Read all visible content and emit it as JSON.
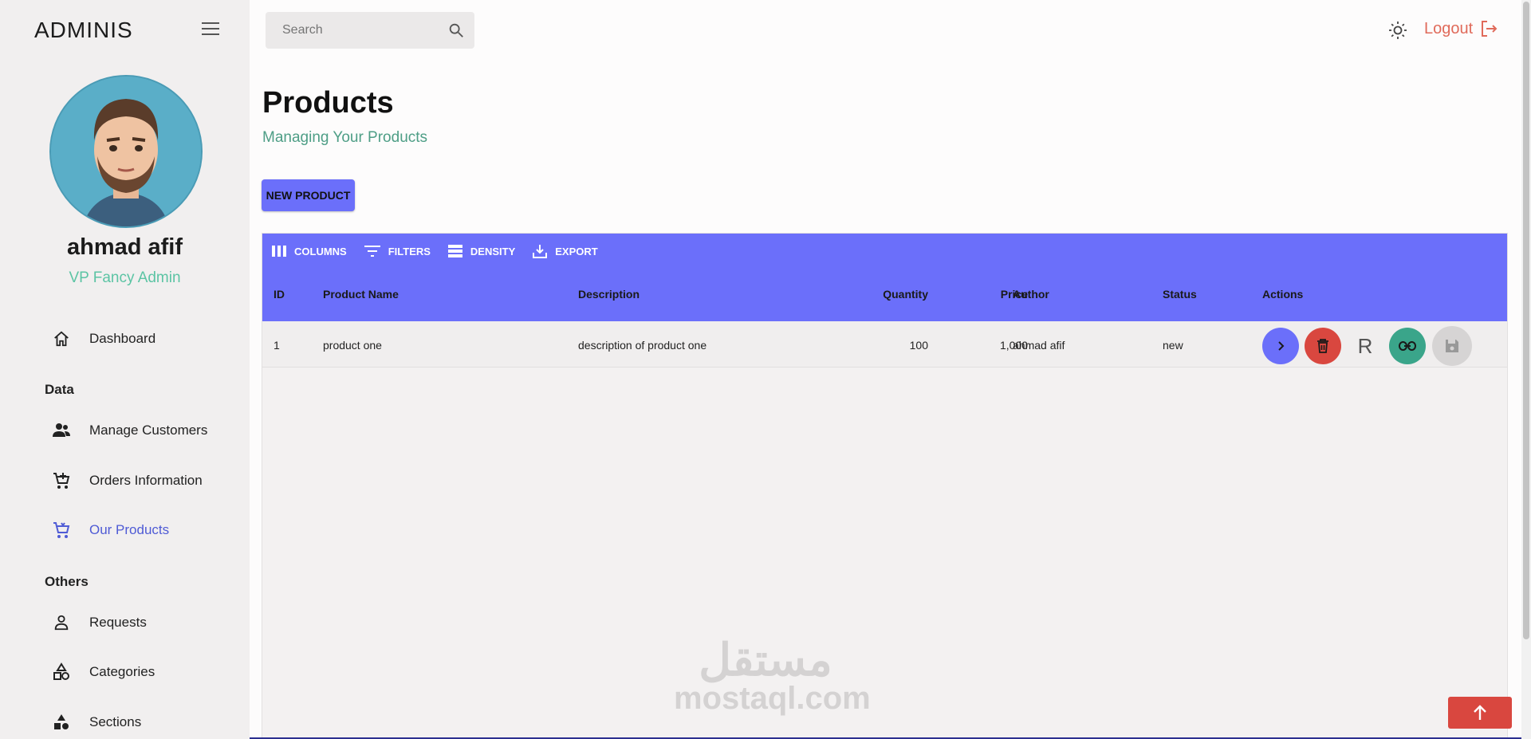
{
  "brand": "ADMINIS",
  "user": {
    "name": "ahmad afif",
    "role": "VP Fancy Admin"
  },
  "nav": {
    "dashboard": "Dashboard",
    "section_data": "Data",
    "customers": "Manage Customers",
    "orders": "Orders Information",
    "products": "Our Products",
    "section_others": "Others",
    "requests": "Requests",
    "categories": "Categories",
    "sections": "Sections"
  },
  "search": {
    "placeholder": "Search"
  },
  "topbar": {
    "logout": "Logout"
  },
  "page": {
    "title": "Products",
    "subtitle": "Managing Your Products",
    "new_button": "NEW PRODUCT"
  },
  "toolbar": {
    "columns": "COLUMNS",
    "filters": "FILTERS",
    "density": "DENSITY",
    "export": "EXPORT"
  },
  "table": {
    "headers": {
      "id": "ID",
      "name": "Product Name",
      "description": "Description",
      "quantity": "Quantity",
      "price": "Price",
      "author": "Author",
      "status": "Status",
      "actions": "Actions"
    },
    "rows": [
      {
        "id": "1",
        "name": "product one",
        "description": "description of product one",
        "quantity": "100",
        "price": "1,000",
        "author": "ahmad afif",
        "status": "new",
        "r_action": "R"
      }
    ]
  },
  "watermark": {
    "arabic": "مستقل",
    "latin": "mostaql.com"
  },
  "colors": {
    "accent": "#6b6ffa",
    "active_nav": "#4f5bd5",
    "logout": "#e06a5a",
    "delete": "#d9473f",
    "link": "#3aa58a"
  }
}
